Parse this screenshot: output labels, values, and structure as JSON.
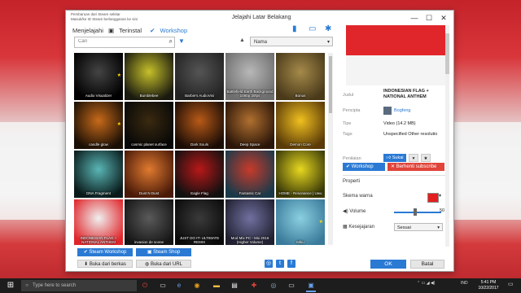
{
  "window": {
    "title": "Jelajahi Latar Belakang",
    "note_line1": "Pembaruan dari Steam sekitar",
    "note_line2": "Masuk/ke ID Steam berlangganan ke sini",
    "controls": [
      "—",
      "☐",
      "✕"
    ]
  },
  "nav": {
    "label": "Menjelajahi",
    "tabs": [
      {
        "label": "Terinstal",
        "active": false
      },
      {
        "label": "Workshop",
        "active": true
      }
    ]
  },
  "search": {
    "placeholder": "Cari"
  },
  "sort": {
    "value": "Nama"
  },
  "tiles": [
    {
      "label": "Audio Visualizer",
      "colors": [
        "#000000",
        "#444444"
      ],
      "star": true
    },
    {
      "label": "Bumblebee",
      "colors": [
        "#1a1a10",
        "#c6c02a"
      ],
      "star": false
    },
    {
      "label": "Barbie's AudioVisi",
      "colors": [
        "#232323",
        "#555555"
      ],
      "star": false
    },
    {
      "label": "Battlefield Earth Background 1080p 30fps",
      "colors": [
        "#6e6e6e",
        "#b8b8b8"
      ],
      "star": false
    },
    {
      "label": "Bonus",
      "colors": [
        "#4a3a1a",
        "#a58a4a"
      ],
      "star": false
    },
    {
      "label": "candle glow",
      "colors": [
        "#1a0f05",
        "#c76a1a"
      ],
      "star": true
    },
    {
      "label": "cosmic planet surface",
      "colors": [
        "#070707",
        "#3a2a10"
      ],
      "star": false
    },
    {
      "label": "Dark Souls",
      "colors": [
        "#1a0c05",
        "#b85a18"
      ],
      "star": false
    },
    {
      "label": "Deep Space",
      "colors": [
        "#2a1508",
        "#b07030"
      ],
      "star": false
    },
    {
      "label": "Demon Core",
      "colors": [
        "#5a3a08",
        "#f0c020"
      ],
      "star": false
    },
    {
      "label": "DNA Fragment",
      "colors": [
        "#0a1a1a",
        "#5ab6b6"
      ],
      "star": false
    },
    {
      "label": "Dust N Dust",
      "colors": [
        "#4a1a08",
        "#e07a30"
      ],
      "star": false
    },
    {
      "label": "Eagle Flag",
      "colors": [
        "#101010",
        "#b81818"
      ],
      "star": false
    },
    {
      "label": "Fantastic Car",
      "colors": [
        "#1a3a4a",
        "#c83a2a"
      ],
      "star": false
    },
    {
      "label": "HOME - Resonance | Uwu",
      "colors": [
        "#3a3a08",
        "#e8d820"
      ],
      "star": false
    },
    {
      "label": "INDONESIAN FLAG + NATIONAL ANTHEM",
      "colors": [
        "#e0262b",
        "#f0f0f0"
      ],
      "star": false
    },
    {
      "label": "invasion de scene",
      "colors": [
        "#151515",
        "#5a5a5a"
      ],
      "star": false
    },
    {
      "label": "JUST DO IT! ULTIMATE REMIX",
      "colors": [
        "#0a0a0a",
        "#3a3a3a"
      ],
      "star": false
    },
    {
      "label": "Mod Mix PC - Mix 2016 (Higher Volume)",
      "colors": [
        "#202030",
        "#7070a0"
      ],
      "star": false
    },
    {
      "label": "Miku",
      "colors": [
        "#3a7a9a",
        "#8ad0e0"
      ],
      "star": true
    }
  ],
  "bottom_buttons": {
    "steam_workshop": "Steam Workshop",
    "steam_shop": "Steam Shop",
    "open_file": "Buka dari berkas",
    "open_url": "Buka dari URL"
  },
  "details": {
    "title_label": "Judul",
    "title_value": "INDONESIAN FLAG + NATIONAL ANTHEM",
    "author_label": "Pencipta",
    "author_value": "Bogfeng",
    "type_label": "Tipe",
    "type_value": "Video (14.2 MB)",
    "tags_label": "Tags",
    "tags_value": "Unspecified Other resolutio",
    "rating_label": "Penilaian",
    "like_label": "Sukai",
    "workshop_button": "Workshop",
    "unsubscribe_button": "Berhenti subscribe",
    "properties_label": "Properti",
    "color_label": "Skema warna",
    "volume_label": "Volume",
    "volume_value": "50",
    "alignment_label": "Kesejajaran",
    "alignment_value": "Sesuai"
  },
  "dialog": {
    "ok": "OK",
    "cancel": "Batal"
  },
  "taskbar": {
    "search_placeholder": "Type here to search",
    "lang": "IND",
    "time": "5:41 PM",
    "date": "10/22/2017"
  },
  "colors": {
    "accent": "#2a7ad4",
    "unsubscribe": "#e0443a",
    "flag_red": "#e0262b"
  }
}
